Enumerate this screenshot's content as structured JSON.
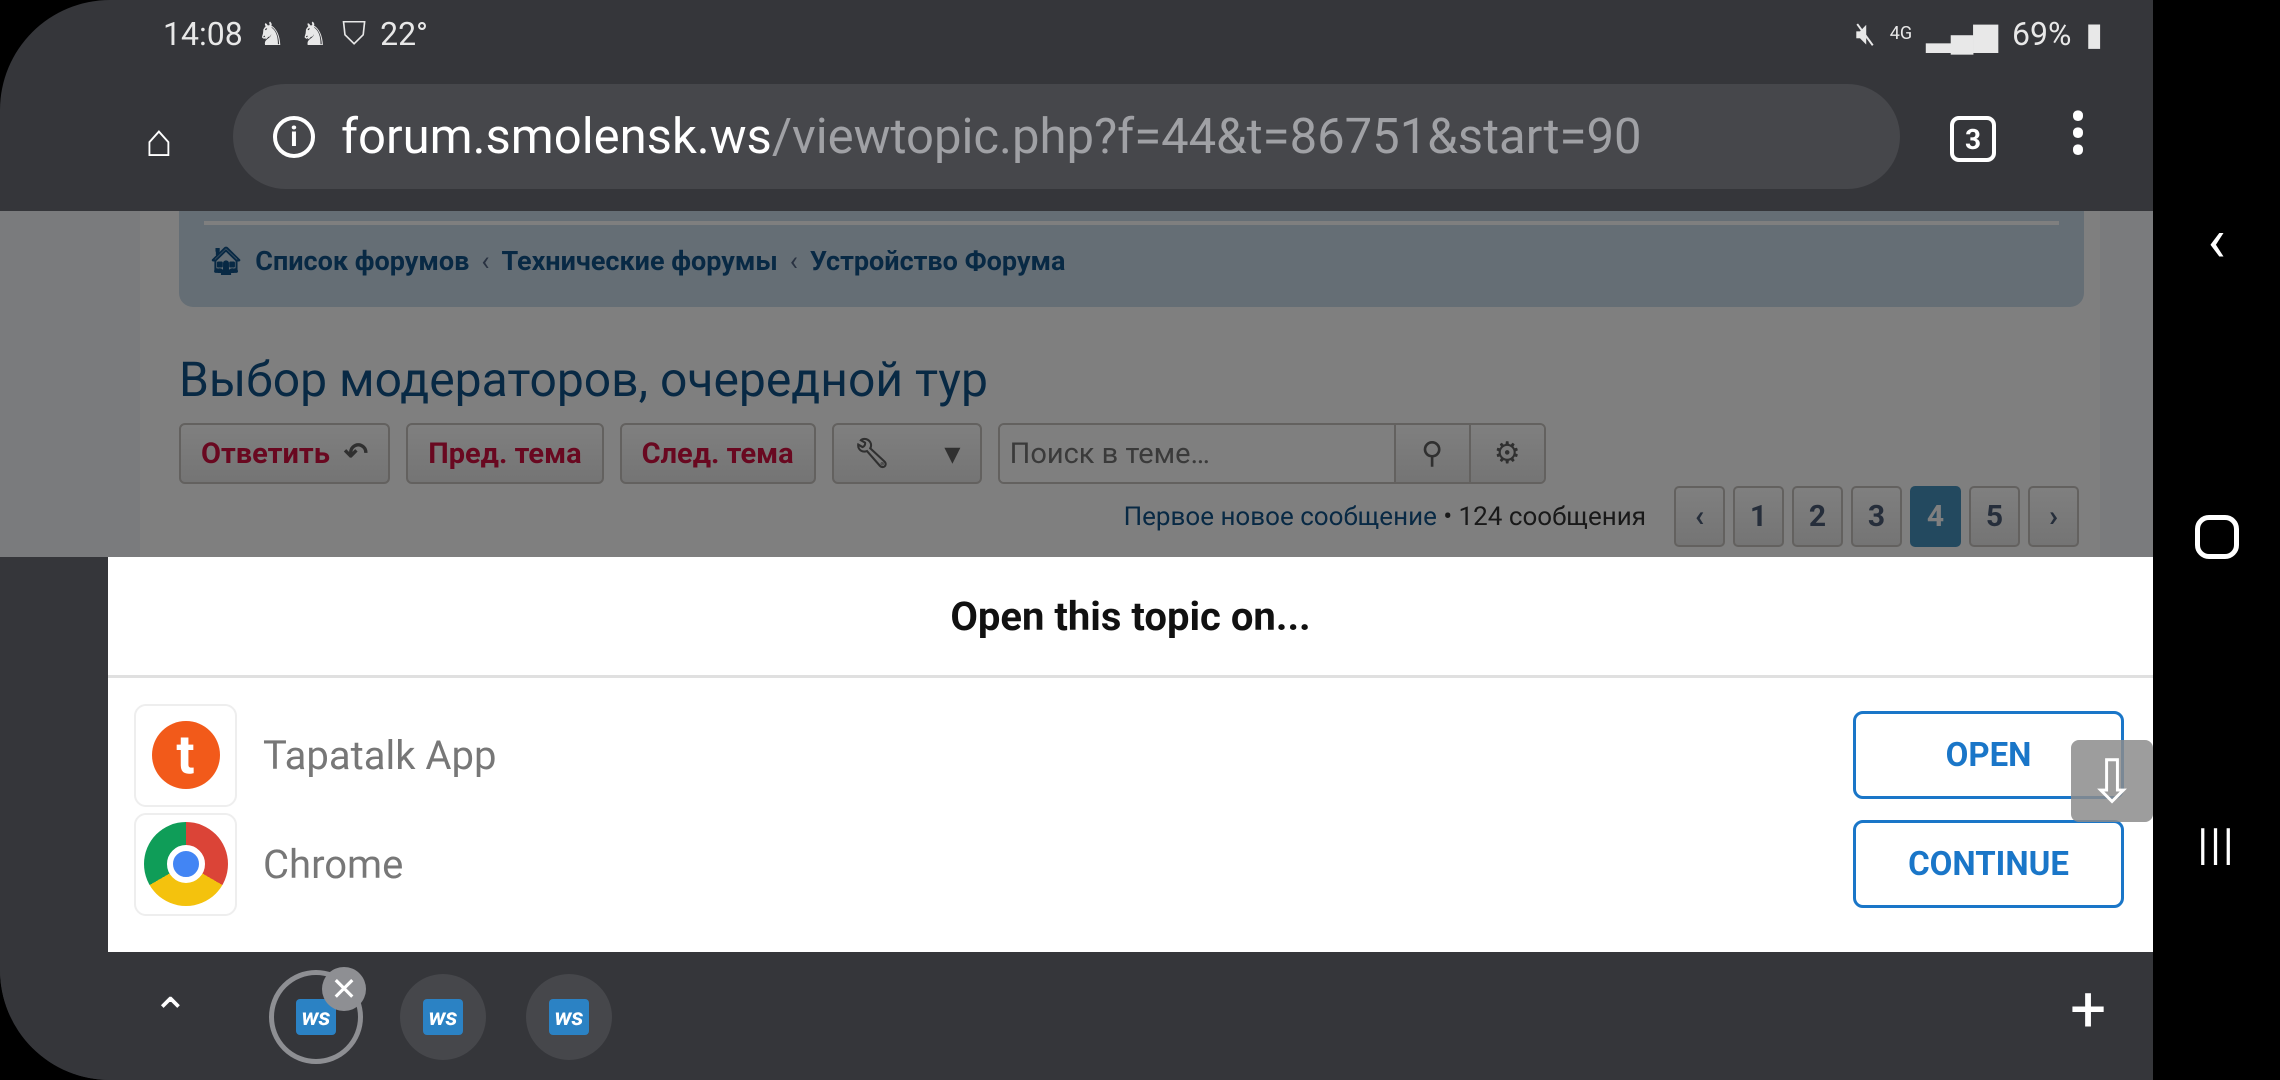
{
  "status": {
    "time": "14:08",
    "temp": "22°",
    "network": "4G",
    "battery": "69%"
  },
  "browser": {
    "url_host": "forum.smolensk.ws",
    "url_path": "/viewtopic.php?f=44&t=86751&start=90",
    "tab_count": "3"
  },
  "page": {
    "breadcrumbs": [
      "Список форумов",
      "Технические форумы",
      "Устройство Форума"
    ],
    "title": "Выбор модераторов, очередной тур",
    "reply": "Ответить",
    "prev": "Пред. тема",
    "next": "След. тема",
    "search_placeholder": "Поиск в теме…",
    "first_new": "Первое новое сообщение",
    "post_count": "• 124 сообщения",
    "pages": [
      "1",
      "2",
      "3",
      "4",
      "5"
    ],
    "current_page": "4"
  },
  "dialog": {
    "title": "Open this topic on...",
    "apps": [
      {
        "name": "Tapatalk App",
        "action": "OPEN"
      },
      {
        "name": "Chrome",
        "action": "CONTINUE"
      }
    ]
  },
  "tabs": {
    "favicon": "ws"
  },
  "colors": {
    "accent": "#1a76c8",
    "link": "#105289",
    "button_text": "#d31141"
  }
}
